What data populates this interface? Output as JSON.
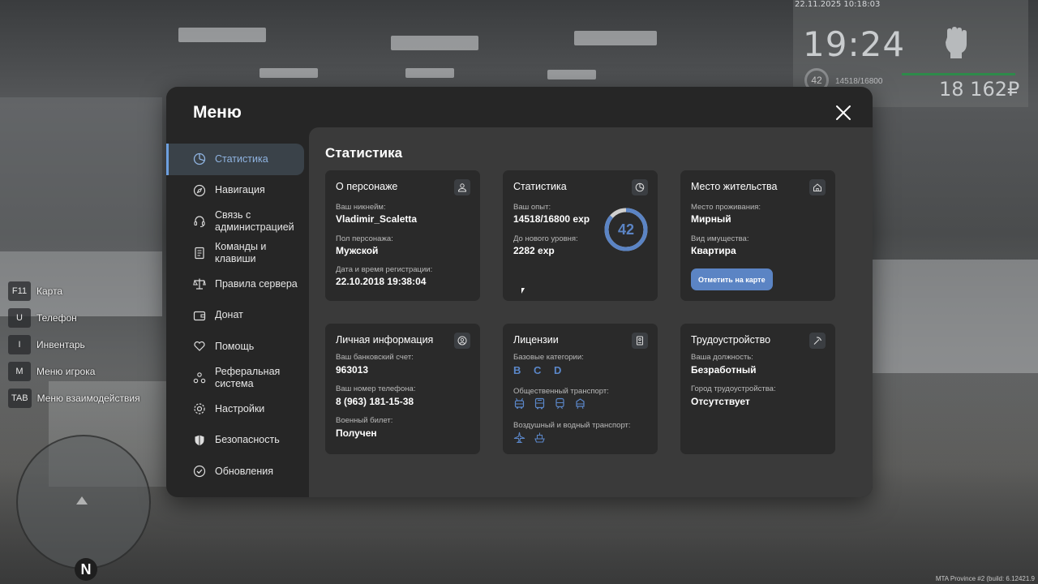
{
  "hud": {
    "datetime": "22.11.2025 10:18:03",
    "time": "19:24",
    "level": "42",
    "exp": "14518/16800",
    "money": "18 162₽"
  },
  "hints": [
    {
      "key": "F11",
      "label": "Карта"
    },
    {
      "key": "U",
      "label": "Телефон"
    },
    {
      "key": "I",
      "label": "Инвентарь"
    },
    {
      "key": "M",
      "label": "Меню игрока"
    },
    {
      "key": "TAB",
      "label": "Меню взаимодействия"
    }
  ],
  "minimap": {
    "north": "N"
  },
  "build": "MTA Province #2 (build: 6.12421.9",
  "menu": {
    "title": "Меню",
    "nav": [
      {
        "label": "Статистика",
        "icon": "pie-chart-icon"
      },
      {
        "label": "Навигация",
        "icon": "compass-icon"
      },
      {
        "label": "Связь с администрацией",
        "icon": "headset-icon"
      },
      {
        "label": "Команды и клавиши",
        "icon": "document-icon"
      },
      {
        "label": "Правила сервера",
        "icon": "scales-icon"
      },
      {
        "label": "Донат",
        "icon": "wallet-icon"
      },
      {
        "label": "Помощь",
        "icon": "heart-hands-icon"
      },
      {
        "label": "Реферальная система",
        "icon": "people-icon"
      },
      {
        "label": "Настройки",
        "icon": "gear-icon"
      },
      {
        "label": "Безопасность",
        "icon": "shield-icon"
      },
      {
        "label": "Обновления",
        "icon": "check-circle-icon"
      }
    ]
  },
  "content": {
    "title": "Статистика",
    "character": {
      "title": "О персонаже",
      "nickname_label": "Ваш никнейм:",
      "nickname": "Vladimir_Scaletta",
      "gender_label": "Пол персонажа:",
      "gender": "Мужской",
      "reg_label": "Дата и время регистрации:",
      "reg": "22.10.2018 19:38:04"
    },
    "stats": {
      "title": "Статистика",
      "exp_label": "Ваш опыт:",
      "exp": "14518/16800 exp",
      "next_label": "До нового уровня:",
      "next": "2282 exp",
      "level": "42",
      "progress": 0.864
    },
    "residence": {
      "title": "Место жительства",
      "place_label": "Место проживания:",
      "place": "Мирный",
      "type_label": "Вид имущества:",
      "type": "Квартира",
      "button": "Отметить на карте"
    },
    "personal": {
      "title": "Личная информация",
      "bank_label": "Ваш банковский счет:",
      "bank": "963013",
      "phone_label": "Ваш номер телефона:",
      "phone": "8 (963) 181-15-38",
      "military_label": "Военный билет:",
      "military": "Получен"
    },
    "licenses": {
      "title": "Лицензии",
      "base_label": "Базовые категории:",
      "base": "B C D",
      "public_label": "Общественный транспорт:",
      "air_label": "Воздушный и водный транспорт:"
    },
    "job": {
      "title": "Трудоустройство",
      "position_label": "Ваша должность:",
      "position": "Безработный",
      "city_label": "Город трудоустройства:",
      "city": "Отсутствует"
    }
  },
  "colors": {
    "accent": "#5b84c4",
    "panel": "#262626",
    "content": "#3a3a3a",
    "card": "#2a2a2a"
  }
}
